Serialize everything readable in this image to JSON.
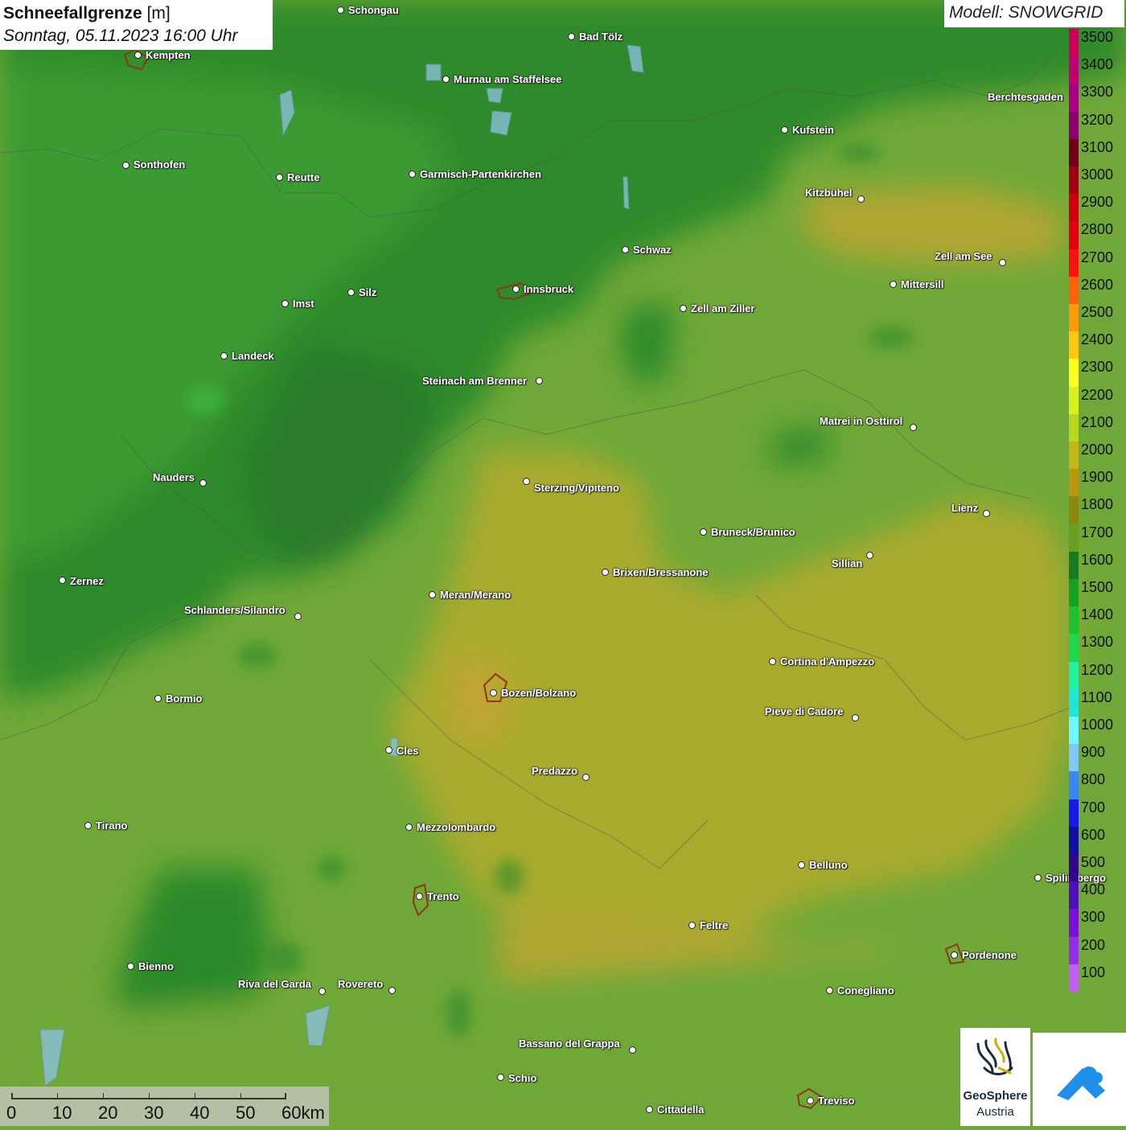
{
  "title": {
    "main_bold": "Schneefallgrenze",
    "main_unit": " [m]",
    "date": "Sonntag, 05.11.2023 16:00 Uhr"
  },
  "model": {
    "label": "Modell: SNOWGRID"
  },
  "legend": {
    "labels": [
      "3500",
      "3400",
      "3300",
      "3200",
      "3100",
      "3000",
      "2900",
      "2800",
      "2700",
      "2600",
      "2500",
      "2400",
      "2300",
      "2200",
      "2100",
      "2000",
      "1900",
      "1800",
      "1700",
      "1600",
      "1500",
      "1400",
      "1300",
      "1200",
      "1100",
      "1000",
      "900",
      "800",
      "700",
      "600",
      "500",
      "400",
      "300",
      "200",
      "100"
    ],
    "colors": [
      "#c8005a",
      "#c00072",
      "#a80080",
      "#8a006a",
      "#6e0018",
      "#a00010",
      "#c80010",
      "#e00010",
      "#ff1010",
      "#ff6010",
      "#ff9a10",
      "#ffc810",
      "#ffff20",
      "#d8f020",
      "#b8d820",
      "#c0b818",
      "#b89810",
      "#8a8a10",
      "#6aa020",
      "#1a7a20",
      "#18a020",
      "#20c030",
      "#20d850",
      "#20f0a0",
      "#20e8d0",
      "#70f8ff",
      "#80c8f8",
      "#3888f0",
      "#1818e8",
      "#1010a0",
      "#300888",
      "#5010b8",
      "#7810d8",
      "#9030e8",
      "#c060f0"
    ]
  },
  "scale": {
    "ticks": [
      "0",
      "10",
      "20",
      "30",
      "40",
      "50",
      "60km"
    ]
  },
  "logos": {
    "geosphere_line1": "GeoSphere",
    "geosphere_line2": "Austria"
  },
  "cities": [
    {
      "name": "Schongau",
      "dot": [
        424,
        13
      ],
      "label": [
        433,
        5
      ]
    },
    {
      "name": "Bad Tölz",
      "dot": [
        711,
        46
      ],
      "label": [
        720,
        38
      ]
    },
    {
      "name": "Kempten",
      "dot": [
        172,
        69
      ],
      "label": [
        181,
        61
      ]
    },
    {
      "name": "Murnau am Staffelsee",
      "dot": [
        555,
        99
      ],
      "label": [
        564,
        91
      ]
    },
    {
      "name": "Berchtesgaden",
      "dot": null,
      "label": [
        1228,
        113
      ]
    },
    {
      "name": "Kufstein",
      "dot": [
        976,
        162
      ],
      "label": [
        985,
        154
      ]
    },
    {
      "name": "Sonthofen",
      "dot": [
        157,
        206
      ],
      "label": [
        166,
        197
      ]
    },
    {
      "name": "Reutte",
      "dot": [
        348,
        221
      ],
      "label": [
        357,
        213
      ]
    },
    {
      "name": "Garmisch-Partenkirchen",
      "dot": [
        513,
        217
      ],
      "label": [
        522,
        209
      ]
    },
    {
      "name": "Kitzbühel",
      "dot": [
        1071,
        248
      ],
      "label": [
        1001,
        232
      ]
    },
    {
      "name": "Schwaz",
      "dot": [
        778,
        311
      ],
      "label": [
        787,
        303
      ]
    },
    {
      "name": "Zell am See",
      "dot": [
        1247,
        327
      ],
      "label": [
        1162,
        311
      ]
    },
    {
      "name": "Innsbruck",
      "dot": [
        642,
        360
      ],
      "label": [
        651,
        352
      ]
    },
    {
      "name": "Mittersill",
      "dot": [
        1111,
        354
      ],
      "label": [
        1120,
        346
      ]
    },
    {
      "name": "Silz",
      "dot": [
        437,
        364
      ],
      "label": [
        446,
        356
      ]
    },
    {
      "name": "Imst",
      "dot": [
        355,
        378
      ],
      "label": [
        364,
        370
      ]
    },
    {
      "name": "Zell am Ziller",
      "dot": [
        850,
        384
      ],
      "label": [
        859,
        376
      ]
    },
    {
      "name": "Landeck",
      "dot": [
        279,
        443
      ],
      "label": [
        288,
        435
      ]
    },
    {
      "name": "Steinach am Brenner",
      "dot": [
        671,
        474
      ],
      "label": [
        525,
        466
      ]
    },
    {
      "name": "Matrei in Osttirol",
      "dot": [
        1136,
        532
      ],
      "label": [
        1019,
        516
      ]
    },
    {
      "name": "Nauders",
      "dot": [
        253,
        601
      ],
      "label": [
        190,
        586
      ]
    },
    {
      "name": "Sterzing/Vipiteno",
      "dot": [
        655,
        599
      ],
      "label": [
        664,
        599
      ]
    },
    {
      "name": "Lienz",
      "dot": [
        1227,
        639
      ],
      "label": [
        1183,
        624
      ]
    },
    {
      "name": "Bruneck/Brunico",
      "dot": [
        875,
        662
      ],
      "label": [
        884,
        654
      ]
    },
    {
      "name": "Sillian",
      "dot": [
        1082,
        691
      ],
      "label": [
        1034,
        693
      ]
    },
    {
      "name": "Brixen/Bressanone",
      "dot": [
        753,
        712
      ],
      "label": [
        762,
        704
      ]
    },
    {
      "name": "Zernez",
      "dot": [
        78,
        722
      ],
      "label": [
        87,
        715
      ]
    },
    {
      "name": "Meran/Merano",
      "dot": [
        538,
        740
      ],
      "label": [
        547,
        732
      ]
    },
    {
      "name": "Schlanders/Silandro",
      "dot": [
        371,
        767
      ],
      "label": [
        229,
        751
      ]
    },
    {
      "name": "Cortina d'Ampezzo",
      "dot": [
        961,
        823
      ],
      "label": [
        970,
        815
      ]
    },
    {
      "name": "Bozen/Bolzano",
      "dot": [
        614,
        862
      ],
      "label": [
        623,
        854
      ]
    },
    {
      "name": "Bormio",
      "dot": [
        197,
        869
      ],
      "label": [
        206,
        861
      ]
    },
    {
      "name": "Pieve di Cadore",
      "dot": [
        1064,
        893
      ],
      "label": [
        951,
        877
      ]
    },
    {
      "name": "Cles",
      "dot": [
        484,
        933
      ],
      "label": [
        493,
        926
      ]
    },
    {
      "name": "Predazzo",
      "dot": [
        729,
        967
      ],
      "label": [
        661,
        951
      ]
    },
    {
      "name": "Tirano",
      "dot": [
        110,
        1027
      ],
      "label": [
        119,
        1019
      ]
    },
    {
      "name": "Mezzolombardo",
      "dot": [
        509,
        1029
      ],
      "label": [
        518,
        1021
      ]
    },
    {
      "name": "Belluno",
      "dot": [
        997,
        1076
      ],
      "label": [
        1006,
        1068
      ]
    },
    {
      "name": "Spilimbergo",
      "dot": [
        1291,
        1092
      ],
      "label": [
        1300,
        1084
      ]
    },
    {
      "name": "Trento",
      "dot": [
        522,
        1115
      ],
      "label": [
        531,
        1107
      ]
    },
    {
      "name": "Feltre",
      "dot": [
        861,
        1151
      ],
      "label": [
        870,
        1143
      ]
    },
    {
      "name": "Pordenone",
      "dot": [
        1187,
        1188
      ],
      "label": [
        1196,
        1180
      ]
    },
    {
      "name": "Bienno",
      "dot": [
        163,
        1202
      ],
      "label": [
        172,
        1194
      ]
    },
    {
      "name": "Riva del Garda",
      "dot": [
        401,
        1233
      ],
      "label": [
        296,
        1216
      ]
    },
    {
      "name": "Rovereto",
      "dot": [
        488,
        1232
      ],
      "label": [
        420,
        1216
      ]
    },
    {
      "name": "Conegliano",
      "dot": [
        1032,
        1232
      ],
      "label": [
        1041,
        1224
      ]
    },
    {
      "name": "Bassano del Grappa",
      "dot": [
        787,
        1306
      ],
      "label": [
        645,
        1290
      ]
    },
    {
      "name": "Schio",
      "dot": [
        623,
        1340
      ],
      "label": [
        632,
        1333
      ]
    },
    {
      "name": "Treviso",
      "dot": [
        1008,
        1369
      ],
      "label": [
        1017,
        1361
      ]
    },
    {
      "name": "Cittadella",
      "dot": [
        808,
        1380
      ],
      "label": [
        817,
        1372
      ]
    }
  ]
}
